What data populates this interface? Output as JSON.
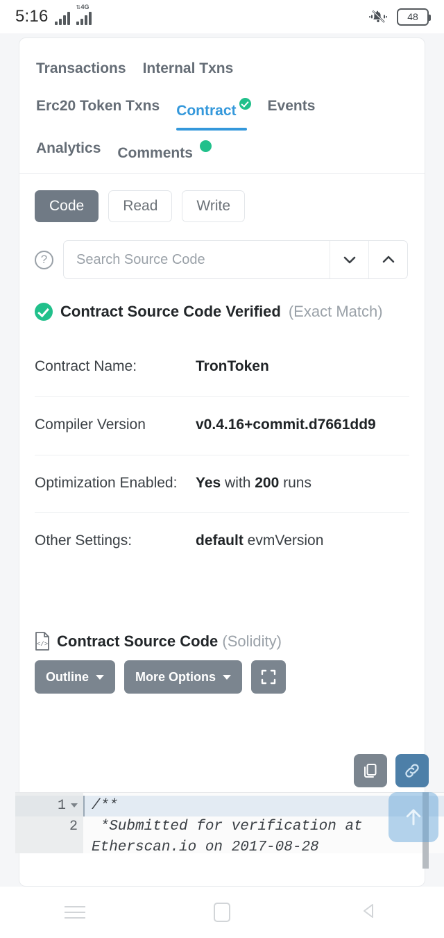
{
  "statusbar": {
    "time": "5:16",
    "network_type": "4G",
    "battery_level": "48",
    "signal_icon": "signal-bars-icon",
    "signal2_icon": "signal-bars-4g-icon",
    "mute_icon": "bell-muted-icon",
    "battery_icon": "battery-icon"
  },
  "tabs": {
    "rows": [
      [
        {
          "label": "Transactions",
          "active": false
        },
        {
          "label": "Internal Txns",
          "active": false
        }
      ],
      [
        {
          "label": "Erc20 Token Txns",
          "active": false
        },
        {
          "label": "Contract",
          "active": true,
          "badge": "check"
        },
        {
          "label": "Events",
          "active": false
        }
      ],
      [
        {
          "label": "Analytics",
          "active": false
        },
        {
          "label": "Comments",
          "active": false,
          "badge": "dot"
        }
      ]
    ]
  },
  "modes": {
    "buttons": [
      {
        "label": "Code",
        "selected": true
      },
      {
        "label": "Read",
        "selected": false
      },
      {
        "label": "Write",
        "selected": false
      }
    ]
  },
  "search": {
    "help_icon": "question-circle-icon",
    "placeholder": "Search Source Code",
    "value": "",
    "next_icon": "chevron-down-icon",
    "prev_icon": "chevron-up-icon"
  },
  "verified": {
    "icon": "verified-check-icon",
    "title": "Contract Source Code Verified",
    "match": "(Exact Match)"
  },
  "details": [
    {
      "label": "Contract Name:",
      "value_strong": "TronToken",
      "value_rest": ""
    },
    {
      "label": "Compiler Version",
      "value_strong": "v0.4.16+commit.d7661dd9",
      "value_rest": ""
    },
    {
      "label": "Optimization Enabled:",
      "value_strong": "Yes",
      "value_rest": " with ",
      "value_strong2": "200",
      "value_rest2": " runs"
    },
    {
      "label": "Other Settings:",
      "value_strong": "default",
      "value_rest": " evmVersion"
    }
  ],
  "source_section": {
    "icon": "file-code-icon",
    "title": "Contract Source Code",
    "language": "(Solidity)",
    "outline_label": "Outline",
    "more_options_label": "More Options",
    "expand_icon": "fullscreen-icon",
    "copy_icon": "copy-icon",
    "link_icon": "link-icon",
    "scroll_top_icon": "arrow-up-icon"
  },
  "editor": {
    "lines": [
      {
        "number": "1",
        "text": "/**",
        "folded": true
      },
      {
        "number": "2",
        "text": " *Submitted for verification at",
        "folded": false
      },
      {
        "number": "",
        "text": "Etherscan.io on 2017-08-28",
        "folded": false
      }
    ]
  },
  "navbar": {
    "recents_icon": "recents-icon",
    "home_icon": "home-icon",
    "back_icon": "back-icon"
  },
  "colors": {
    "accent_blue": "#3498db",
    "verified_green": "#21c08b",
    "button_gray": "#7b858f",
    "page_bg": "#f5f6f8"
  }
}
